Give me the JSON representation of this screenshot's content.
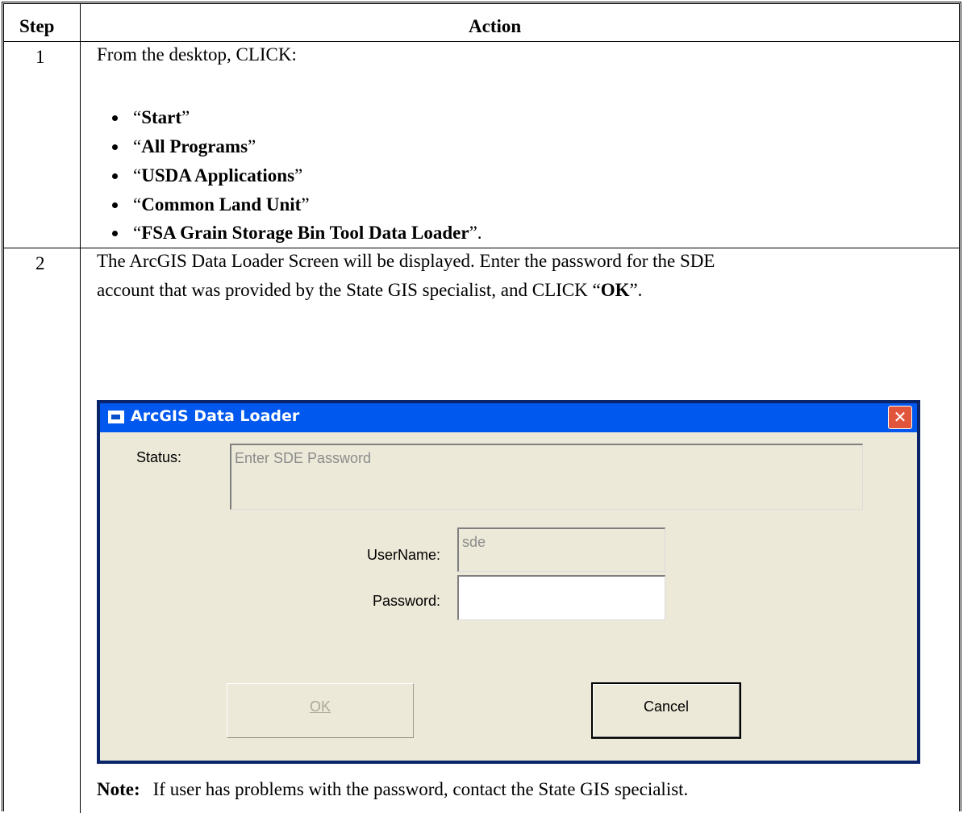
{
  "table": {
    "header_step": "Step",
    "header_action": "Action",
    "rows": [
      {
        "step": "1",
        "intro": "From the desktop, CLICK:",
        "bullets": [
          {
            "open": "“",
            "bold": "Start",
            "close": "”"
          },
          {
            "open": "“",
            "bold": "All Programs",
            "close": "”"
          },
          {
            "open": "“",
            "bold": "USDA Applications",
            "close": "”"
          },
          {
            "open": "“",
            "bold": "Common Land Unit",
            "close": "”"
          },
          {
            "open": "“",
            "bold": "FSA Grain Storage Bin Tool Data Loader",
            "close": "”."
          }
        ]
      },
      {
        "step": "2",
        "line1": "The ArcGIS Data Loader Screen will be displayed.  Enter the password for the SDE",
        "line2_pre": "account that was provided by the State GIS specialist, and CLICK “",
        "line2_bold": "OK",
        "line2_post": "”.",
        "note_label": "Note:",
        "note_text": "If user has problems with the password, contact the State GIS specialist."
      }
    ]
  },
  "dialog": {
    "title": "ArcGIS Data Loader",
    "close_glyph": "✕",
    "status_label": "Status:",
    "status_value": "Enter SDE Password",
    "username_label": "UserName:",
    "username_value": "sde",
    "password_label": "Password:",
    "password_value": "",
    "ok_label": "OK",
    "cancel_label": "Cancel"
  }
}
